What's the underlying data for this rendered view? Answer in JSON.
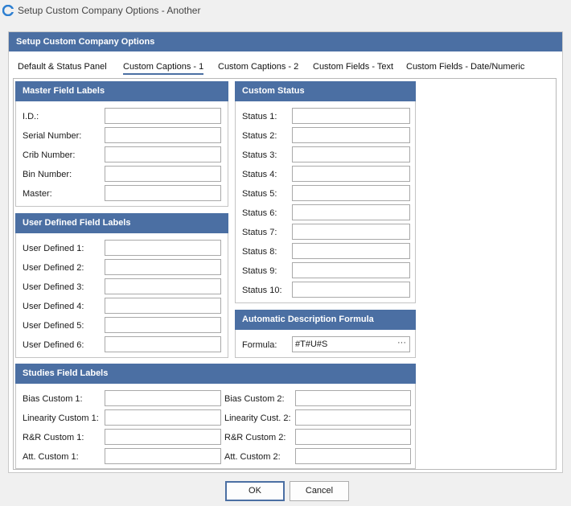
{
  "window": {
    "title": "Setup Custom Company Options - Another"
  },
  "dialog": {
    "header": "Setup Custom Company Options"
  },
  "tabs": [
    {
      "label": "Default & Status Panel"
    },
    {
      "label": "Custom Captions - 1"
    },
    {
      "label": "Custom Captions - 2"
    },
    {
      "label": "Custom Fields - Text"
    },
    {
      "label": "Custom Fields - Date/Numeric"
    }
  ],
  "active_tab": "Custom Captions - 1",
  "master": {
    "header": "Master Field Labels",
    "fields": [
      {
        "label": "I.D.:",
        "value": ""
      },
      {
        "label": "Serial Number:",
        "value": ""
      },
      {
        "label": "Crib Number:",
        "value": ""
      },
      {
        "label": "Bin Number:",
        "value": ""
      },
      {
        "label": "Master:",
        "value": ""
      }
    ]
  },
  "user_defined": {
    "header": "User Defined Field Labels",
    "fields": [
      {
        "label": "User Defined 1:",
        "value": ""
      },
      {
        "label": "User Defined 2:",
        "value": ""
      },
      {
        "label": "User Defined 3:",
        "value": ""
      },
      {
        "label": "User Defined 4:",
        "value": ""
      },
      {
        "label": "User Defined 5:",
        "value": ""
      },
      {
        "label": "User Defined 6:",
        "value": ""
      }
    ]
  },
  "custom_status": {
    "header": "Custom Status",
    "fields": [
      {
        "label": "Status 1:",
        "value": ""
      },
      {
        "label": "Status 2:",
        "value": ""
      },
      {
        "label": "Status 3:",
        "value": ""
      },
      {
        "label": "Status 4:",
        "value": ""
      },
      {
        "label": "Status 5:",
        "value": ""
      },
      {
        "label": "Status 6:",
        "value": ""
      },
      {
        "label": "Status 7:",
        "value": ""
      },
      {
        "label": "Status 8:",
        "value": ""
      },
      {
        "label": "Status 9:",
        "value": ""
      },
      {
        "label": "Status 10:",
        "value": ""
      }
    ]
  },
  "formula": {
    "header": "Automatic Description Formula",
    "label": "Formula:",
    "value": "#T#U#S",
    "ellipsis": "···"
  },
  "studies": {
    "header": "Studies Field Labels",
    "left": [
      {
        "label": "Bias Custom 1:",
        "value": ""
      },
      {
        "label": "Linearity Custom 1:",
        "value": ""
      },
      {
        "label": "R&R Custom 1:",
        "value": ""
      },
      {
        "label": "Att. Custom 1:",
        "value": ""
      }
    ],
    "right": [
      {
        "label": "Bias Custom 2:",
        "value": ""
      },
      {
        "label": "Linearity Cust. 2:",
        "value": ""
      },
      {
        "label": "R&R Custom 2:",
        "value": ""
      },
      {
        "label": "Att. Custom 2:",
        "value": ""
      }
    ]
  },
  "buttons": {
    "ok": "OK",
    "cancel": "Cancel"
  },
  "colors": {
    "accent": "#4b6fa3",
    "app_icon": "#2d7fd1"
  }
}
